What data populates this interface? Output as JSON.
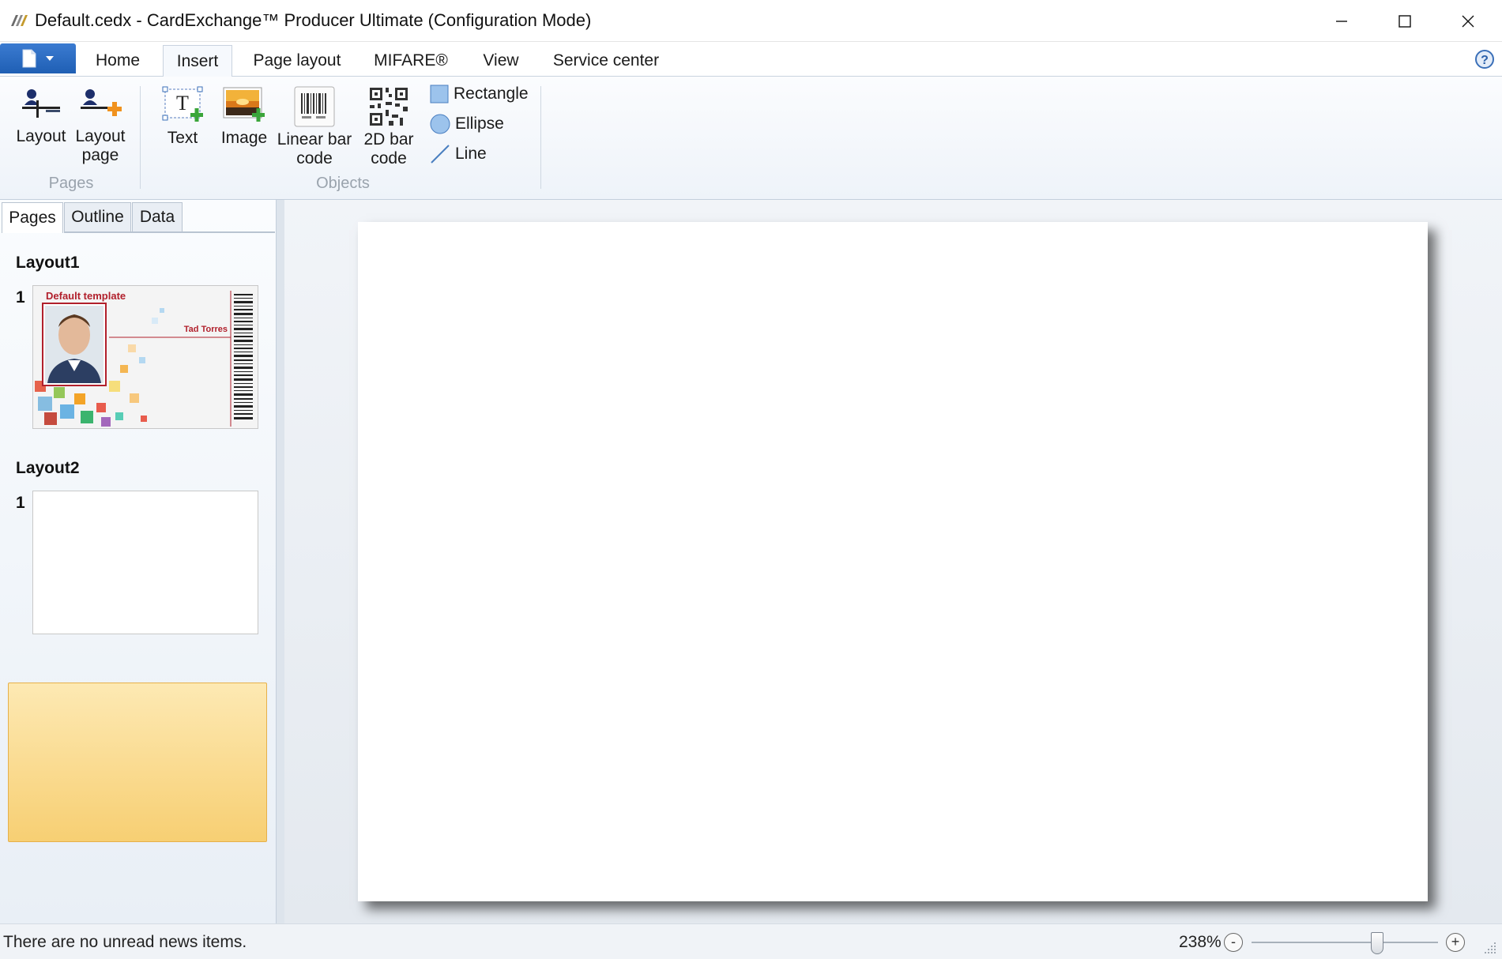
{
  "window": {
    "title": "Default.cedx - CardExchange™ Producer Ultimate (Configuration Mode)",
    "controls": [
      "minimize",
      "maximize",
      "close"
    ]
  },
  "ribbon": {
    "tabs": [
      {
        "label": "Home",
        "active": false
      },
      {
        "label": "Insert",
        "active": true
      },
      {
        "label": "Page layout",
        "active": false
      },
      {
        "label": "MIFARE®",
        "active": false
      },
      {
        "label": "View",
        "active": false
      },
      {
        "label": "Service center",
        "active": false
      }
    ],
    "groups": {
      "pages": {
        "label": "Pages",
        "buttons": [
          {
            "label": "Layout",
            "icon": "layout-icon"
          },
          {
            "label": "Layout\npage",
            "icon": "layout-page-icon"
          }
        ]
      },
      "objects": {
        "label": "Objects",
        "buttons": [
          {
            "label": "Text",
            "icon": "text-insert-icon"
          },
          {
            "label": "Image",
            "icon": "image-insert-icon"
          },
          {
            "label": "Linear bar\ncode",
            "icon": "linear-barcode-icon"
          },
          {
            "label": "2D bar\ncode",
            "icon": "qr-code-icon"
          }
        ],
        "small_buttons": [
          {
            "label": "Rectangle",
            "icon": "rectangle-icon"
          },
          {
            "label": "Ellipse",
            "icon": "ellipse-icon"
          },
          {
            "label": "Line",
            "icon": "line-icon"
          }
        ]
      }
    }
  },
  "left_panel": {
    "tabs": [
      {
        "label": "Pages",
        "active": true
      },
      {
        "label": "Outline",
        "active": false
      },
      {
        "label": "Data",
        "active": false
      }
    ],
    "layouts": [
      {
        "title": "Layout1",
        "pages": [
          {
            "number": "1",
            "selected": false,
            "thumb_title": "Default template",
            "thumb_name": "Tad Torres"
          }
        ]
      },
      {
        "title": "Layout2",
        "pages": [
          {
            "number": "1",
            "selected": true
          }
        ]
      }
    ]
  },
  "status": {
    "message": "There are no unread news items.",
    "zoom": "238%",
    "zoom_minus": "-",
    "zoom_plus": "+"
  },
  "colors": {
    "accent": "#1f5fb4",
    "selection": "#f7cf73",
    "thumb_title_red": "#b1202c"
  }
}
